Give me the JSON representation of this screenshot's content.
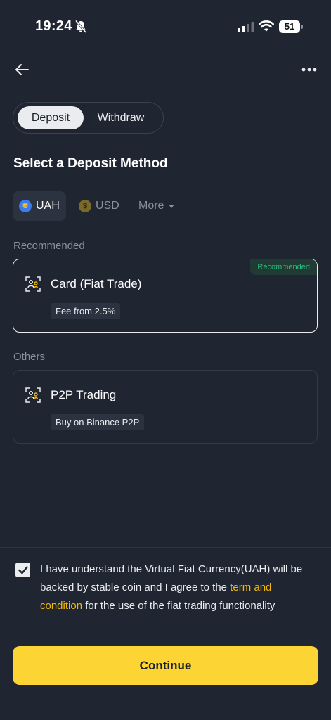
{
  "status_bar": {
    "time": "19:24",
    "battery": "51"
  },
  "tabs": {
    "deposit": "Deposit",
    "withdraw": "Withdraw"
  },
  "page_title": "Select a Deposit Method",
  "currencies": {
    "uah": "UAH",
    "usd": "USD",
    "more": "More"
  },
  "groups": {
    "recommended": "Recommended",
    "others": "Others"
  },
  "methods": [
    {
      "name": "Card (Fiat Trade)",
      "tag": "Fee from 2.5%",
      "badge": "Recommended"
    },
    {
      "name": "P2P Trading",
      "tag": "Buy on Binance P2P"
    }
  ],
  "agreement": {
    "text_1": "I have understand the Virtual Fiat Currency(UAH) will be backed by stable coin and I agree to the ",
    "link": "term and condition",
    "text_2": " for the use of the fiat trading functionality"
  },
  "continue_label": "Continue",
  "colors": {
    "accent": "#fcd535",
    "link": "#f0b90b",
    "badge_text": "#2ebd85",
    "background": "#1f2631"
  },
  "icons": [
    "bell-slash-icon",
    "signal-icon",
    "wifi-icon",
    "battery-icon",
    "arrow-left-icon",
    "more-dots-icon",
    "uah-coin-icon",
    "usd-coin-icon",
    "caret-down-icon",
    "user-card-icon",
    "checkmark-icon"
  ]
}
